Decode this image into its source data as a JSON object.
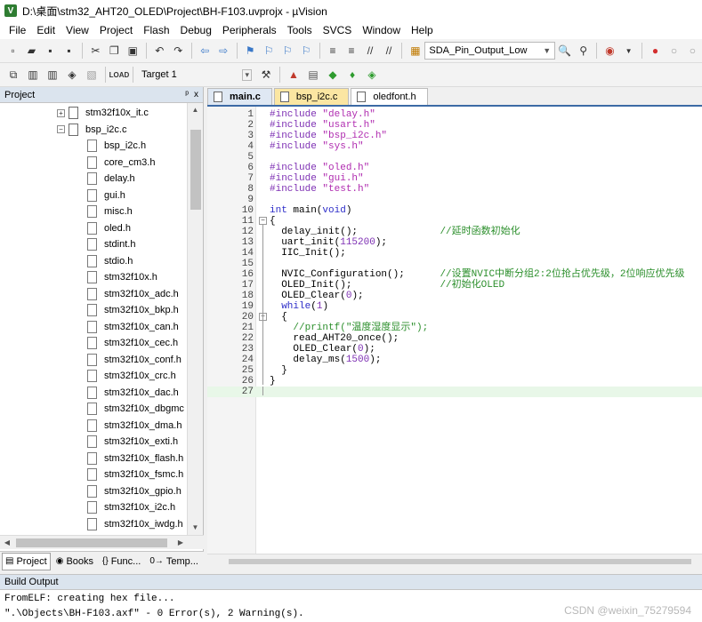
{
  "window": {
    "app_icon": "V",
    "title": "D:\\桌面\\stm32_AHT20_OLED\\Project\\BH-F103.uvprojx - µVision"
  },
  "menu": [
    "File",
    "Edit",
    "View",
    "Project",
    "Flash",
    "Debug",
    "Peripherals",
    "Tools",
    "SVCS",
    "Window",
    "Help"
  ],
  "toolbar": {
    "function_combo": "SDA_Pin_Output_Low",
    "target_combo": "Target 1",
    "icons_row1": [
      "new-file-icon",
      "open-folder-icon",
      "save-icon",
      "save-all-icon",
      "cut-icon",
      "copy-icon",
      "paste-icon",
      "undo-icon",
      "redo-icon",
      "nav-back-icon",
      "nav-forward-icon",
      "bookmark-icon",
      "prev-bookmark-icon",
      "next-bookmark-icon",
      "clear-bookmarks-icon",
      "indent-icon",
      "unindent-icon",
      "comment-icon",
      "uncomment-icon",
      "find-in-files-icon",
      "find-icon",
      "debug-icon",
      "breakpoint-icon",
      "disable-breakpoint-icon"
    ],
    "icons_row2": [
      "translate-icon",
      "build-icon",
      "rebuild-icon",
      "batch-build-icon",
      "stop-build-icon",
      "download-icon",
      "target-options-icon",
      "manage-project-icon",
      "manage-rte-icon",
      "select-packs-icon"
    ]
  },
  "project_pane": {
    "title": "Project",
    "pin": "ᵖ",
    "close": "x",
    "tree": [
      {
        "label": "stm32f10x_it.c",
        "type": "c",
        "expand": "+",
        "indent": 1
      },
      {
        "label": "bsp_i2c.c",
        "type": "c",
        "expand": "−",
        "indent": 1
      },
      {
        "label": "bsp_i2c.h",
        "type": "h",
        "indent": 2
      },
      {
        "label": "core_cm3.h",
        "type": "h",
        "indent": 2
      },
      {
        "label": "delay.h",
        "type": "h",
        "indent": 2
      },
      {
        "label": "gui.h",
        "type": "h",
        "indent": 2
      },
      {
        "label": "misc.h",
        "type": "h",
        "indent": 2
      },
      {
        "label": "oled.h",
        "type": "h",
        "indent": 2
      },
      {
        "label": "stdint.h",
        "type": "h",
        "indent": 2
      },
      {
        "label": "stdio.h",
        "type": "h",
        "indent": 2
      },
      {
        "label": "stm32f10x.h",
        "type": "h",
        "indent": 2
      },
      {
        "label": "stm32f10x_adc.h",
        "type": "h",
        "indent": 2
      },
      {
        "label": "stm32f10x_bkp.h",
        "type": "h",
        "indent": 2
      },
      {
        "label": "stm32f10x_can.h",
        "type": "h",
        "indent": 2
      },
      {
        "label": "stm32f10x_cec.h",
        "type": "h",
        "indent": 2
      },
      {
        "label": "stm32f10x_conf.h",
        "type": "h",
        "indent": 2
      },
      {
        "label": "stm32f10x_crc.h",
        "type": "h",
        "indent": 2
      },
      {
        "label": "stm32f10x_dac.h",
        "type": "h",
        "indent": 2
      },
      {
        "label": "stm32f10x_dbgmc",
        "type": "h",
        "indent": 2
      },
      {
        "label": "stm32f10x_dma.h",
        "type": "h",
        "indent": 2
      },
      {
        "label": "stm32f10x_exti.h",
        "type": "h",
        "indent": 2
      },
      {
        "label": "stm32f10x_flash.h",
        "type": "h",
        "indent": 2
      },
      {
        "label": "stm32f10x_fsmc.h",
        "type": "h",
        "indent": 2
      },
      {
        "label": "stm32f10x_gpio.h",
        "type": "h",
        "indent": 2
      },
      {
        "label": "stm32f10x_i2c.h",
        "type": "h",
        "indent": 2
      },
      {
        "label": "stm32f10x_iwdg.h",
        "type": "h",
        "indent": 2
      }
    ],
    "tabs": [
      {
        "label": "Project",
        "icon": "project-icon",
        "glyph": "▤"
      },
      {
        "label": "Books",
        "icon": "books-icon",
        "glyph": "◉"
      },
      {
        "label": "Func...",
        "icon": "functions-icon",
        "glyph": "{}"
      },
      {
        "label": "Temp...",
        "icon": "templates-icon",
        "glyph": "0→"
      }
    ]
  },
  "editor": {
    "tabs": [
      {
        "label": "main.c",
        "state": "active"
      },
      {
        "label": "bsp_i2c.c",
        "state": "highlight"
      },
      {
        "label": "oledfont.h",
        "state": "normal"
      }
    ],
    "lines": [
      {
        "n": "1",
        "segs": [
          [
            "pp",
            "#include "
          ],
          [
            "str",
            "\"delay.h\""
          ]
        ]
      },
      {
        "n": "2",
        "segs": [
          [
            "pp",
            "#include "
          ],
          [
            "str",
            "\"usart.h\""
          ]
        ]
      },
      {
        "n": "3",
        "segs": [
          [
            "pp",
            "#include "
          ],
          [
            "str",
            "\"bsp_i2c.h\""
          ]
        ]
      },
      {
        "n": "4",
        "segs": [
          [
            "pp",
            "#include "
          ],
          [
            "str",
            "\"sys.h\""
          ]
        ]
      },
      {
        "n": "5",
        "segs": []
      },
      {
        "n": "6",
        "segs": [
          [
            "pp",
            "#include "
          ],
          [
            "str",
            "\"oled.h\""
          ]
        ]
      },
      {
        "n": "7",
        "segs": [
          [
            "pp",
            "#include "
          ],
          [
            "str",
            "\"gui.h\""
          ]
        ]
      },
      {
        "n": "8",
        "segs": [
          [
            "pp",
            "#include "
          ],
          [
            "str",
            "\"test.h\""
          ]
        ]
      },
      {
        "n": "9",
        "segs": []
      },
      {
        "n": "10",
        "segs": [
          [
            "kw",
            "int "
          ],
          [
            "",
            "main("
          ],
          [
            "kw",
            "void"
          ],
          [
            "",
            ")"
          ]
        ]
      },
      {
        "n": "11",
        "fold": "−",
        "segs": [
          [
            "",
            "{"
          ]
        ]
      },
      {
        "n": "12",
        "segs": [
          [
            "",
            "  delay_init();              "
          ],
          [
            "cmt",
            "//延时函数初始化"
          ]
        ]
      },
      {
        "n": "13",
        "segs": [
          [
            "",
            "  uart_init("
          ],
          [
            "num",
            "115200"
          ],
          [
            "",
            ");"
          ]
        ]
      },
      {
        "n": "14",
        "segs": [
          [
            "",
            "  IIC_Init();"
          ]
        ]
      },
      {
        "n": "15",
        "segs": []
      },
      {
        "n": "16",
        "segs": [
          [
            "",
            "  NVIC_Configuration();      "
          ],
          [
            "cmt",
            "//设置NVIC中断分组2:2位抢占优先级，2位响应优先级"
          ]
        ]
      },
      {
        "n": "17",
        "segs": [
          [
            "",
            "  OLED_Init();               "
          ],
          [
            "cmt",
            "//初始化OLED"
          ]
        ]
      },
      {
        "n": "18",
        "segs": [
          [
            "",
            "  OLED_Clear("
          ],
          [
            "num",
            "0"
          ],
          [
            "",
            ");"
          ]
        ]
      },
      {
        "n": "19",
        "segs": [
          [
            "kw",
            "  while"
          ],
          [
            "",
            "("
          ],
          [
            "num",
            "1"
          ],
          [
            "",
            ")"
          ]
        ]
      },
      {
        "n": "20",
        "fold": "−",
        "segs": [
          [
            "",
            "  {"
          ]
        ]
      },
      {
        "n": "21",
        "segs": [
          [
            "cmt",
            "    //printf(\"温度湿度显示\");"
          ]
        ]
      },
      {
        "n": "22",
        "segs": [
          [
            "",
            "    read_AHT20_once();"
          ]
        ]
      },
      {
        "n": "23",
        "segs": [
          [
            "",
            "    OLED_Clear("
          ],
          [
            "num",
            "0"
          ],
          [
            "",
            ");"
          ]
        ]
      },
      {
        "n": "24",
        "segs": [
          [
            "",
            "    delay_ms("
          ],
          [
            "num",
            "1500"
          ],
          [
            "",
            ");"
          ]
        ]
      },
      {
        "n": "25",
        "segs": [
          [
            "",
            "  }"
          ]
        ]
      },
      {
        "n": "26",
        "segs": [
          [
            "",
            "}"
          ]
        ]
      },
      {
        "n": "27",
        "segs": [],
        "current": true
      }
    ]
  },
  "build_output": {
    "title": "Build Output",
    "lines": [
      "FromELF: creating hex file...",
      "\".\\Objects\\BH-F103.axf\" - 0 Error(s), 2 Warning(s)."
    ]
  },
  "watermark": "CSDN @weixin_75279594",
  "colors": {
    "keyword": "#2d2dc8",
    "preprocessor": "#7d2fb3",
    "string": "#b02cb0",
    "comment": "#2c8f2c",
    "active_tab": "#dfe8f3",
    "highlight_tab": "#fbe6a2"
  }
}
